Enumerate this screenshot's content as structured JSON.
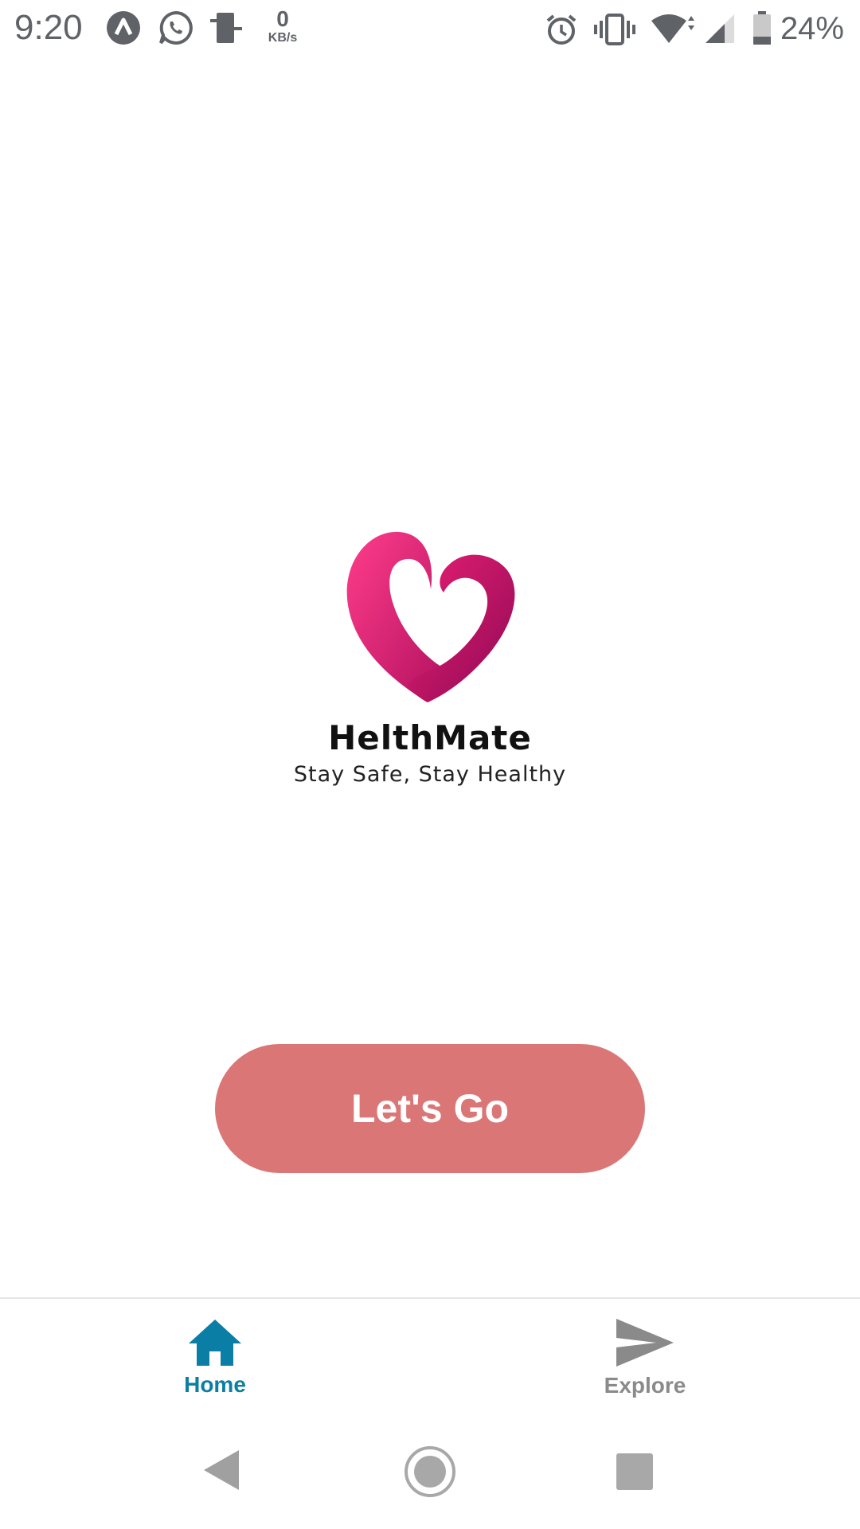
{
  "status_bar": {
    "time": "9:20",
    "net_speed_value": "0",
    "net_speed_unit": "KB/s",
    "battery_percent": "24%",
    "icons": [
      "app-notification-icon",
      "whatsapp-icon",
      "screen-cast-icon",
      "alarm-icon",
      "vibrate-icon",
      "wifi-icon",
      "signal-icon",
      "battery-icon"
    ]
  },
  "app": {
    "name": "HelthMate",
    "tagline": "Stay Safe, Stay Healthy",
    "logo_icon": "heart-logo",
    "cta_label": "Let's Go",
    "cta_color": "#db7676"
  },
  "bottom_nav": {
    "items": [
      {
        "label": "Home",
        "icon": "home-icon",
        "active": true,
        "color": "#0b7ea5"
      },
      {
        "label": "Explore",
        "icon": "send-icon",
        "active": false,
        "color": "#8a8a8a"
      }
    ]
  },
  "system_nav": {
    "icons": [
      "back-icon",
      "home-circle-icon",
      "recents-icon"
    ]
  }
}
